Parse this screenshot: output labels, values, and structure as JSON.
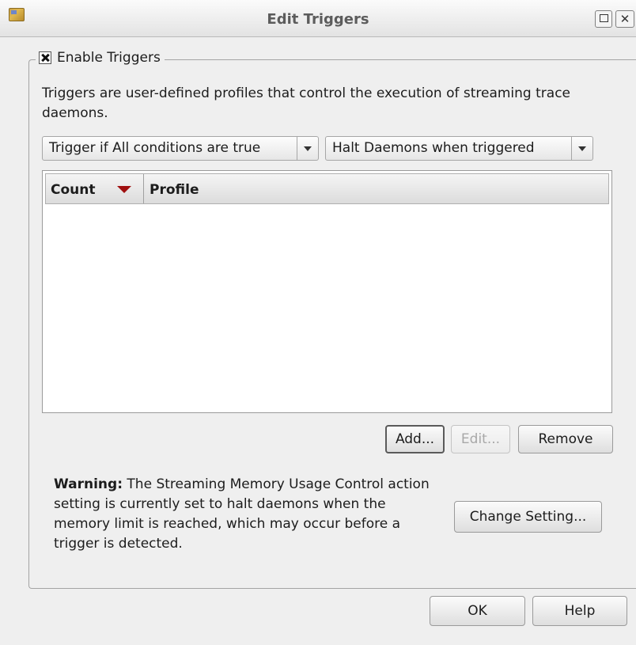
{
  "window": {
    "title": "Edit Triggers"
  },
  "triggers_group": {
    "enable_label": "Enable Triggers",
    "enable_checked": true,
    "description": "Triggers are user-defined profiles that control the execution of streaming trace daemons."
  },
  "condition_select": {
    "value": "Trigger if All conditions are true"
  },
  "action_select": {
    "value": "Halt Daemons when triggered"
  },
  "table": {
    "columns": [
      "Count",
      "Profile"
    ],
    "sort_column": "Count",
    "sort_direction": "descending",
    "rows": []
  },
  "table_buttons": {
    "add": "Add...",
    "edit": "Edit...",
    "remove": "Remove"
  },
  "warning": {
    "prefix": "Warning:",
    "text": " The Streaming Memory Usage Control action setting is currently set to halt daemons when the memory limit is reached, which may occur before a trigger is detected.",
    "button": "Change Setting..."
  },
  "footer": {
    "ok": "OK",
    "help": "Help"
  },
  "colors": {
    "sort_arrow": "#a01010",
    "background": "#efefef"
  }
}
